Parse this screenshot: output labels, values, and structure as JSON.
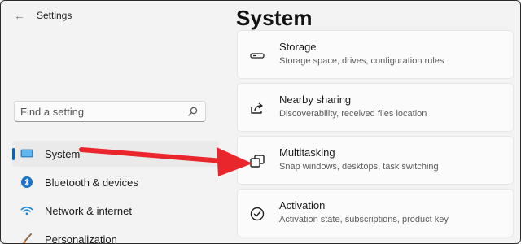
{
  "window": {
    "back_glyph": "←",
    "title": "Settings"
  },
  "search": {
    "placeholder": "Find a setting",
    "icon": "search-icon"
  },
  "sidebar": {
    "items": [
      {
        "label": "System",
        "icon": "system-display-icon",
        "selected": true
      },
      {
        "label": "Bluetooth & devices",
        "icon": "bluetooth-icon",
        "selected": false
      },
      {
        "label": "Network & internet",
        "icon": "wifi-icon",
        "selected": false
      },
      {
        "label": "Personalization",
        "icon": "paintbrush-icon",
        "selected": false
      }
    ]
  },
  "main": {
    "title": "System",
    "cards": [
      {
        "title": "Storage",
        "description": "Storage space, drives, configuration rules",
        "icon": "storage-drive-icon"
      },
      {
        "title": "Nearby sharing",
        "description": "Discoverability, received files location",
        "icon": "share-icon"
      },
      {
        "title": "Multitasking",
        "description": "Snap windows, desktops, task switching",
        "icon": "multitasking-icon"
      },
      {
        "title": "Activation",
        "description": "Activation state, subscriptions, product key",
        "icon": "activation-check-icon"
      }
    ]
  },
  "annotation": {
    "arrow_color": "#e8262b"
  },
  "colors": {
    "accent": "#0067c0",
    "window_bg": "#f3f3f3",
    "card_bg": "#fbfbfb"
  }
}
